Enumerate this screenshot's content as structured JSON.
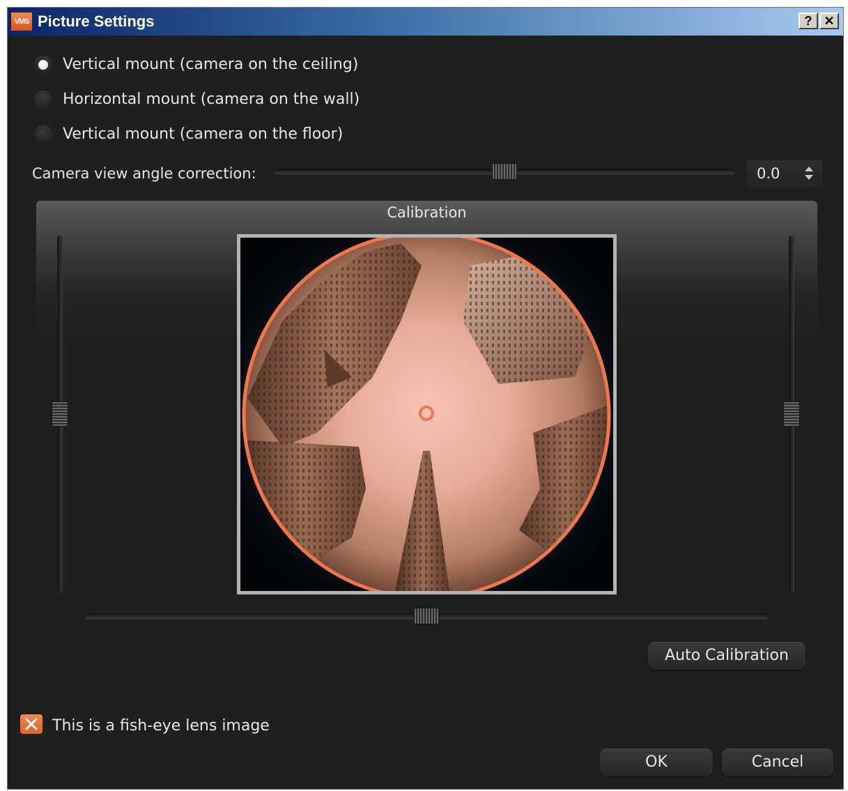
{
  "window": {
    "title": "Picture Settings",
    "logo_text": "VMS",
    "help_button": "?",
    "close_button": "✕"
  },
  "mount_options": [
    {
      "label": "Vertical mount (camera on the ceiling)",
      "checked": true
    },
    {
      "label": "Horizontal mount (camera on the wall)",
      "checked": false
    },
    {
      "label": "Vertical mount (camera on the floor)",
      "checked": false
    }
  ],
  "angle_correction": {
    "label": "Camera view angle correction:",
    "value": "0.0",
    "slider_position": 0.5
  },
  "calibration": {
    "title": "Calibration",
    "horizontal_slider_position": 0.5,
    "left_slider_position": 0.5,
    "right_slider_position": 0.5,
    "auto_button": "Auto Calibration"
  },
  "fisheye_checkbox": {
    "label": "This is a fish-eye lens image",
    "checked": true,
    "check_icon": "✕"
  },
  "footer": {
    "ok_button": "OK",
    "cancel_button": "Cancel"
  },
  "colors": {
    "accent": "#f0774a",
    "background": "#1f1f1f",
    "text": "#e6e6e6"
  },
  "icons": {
    "logo": "vms-logo-icon",
    "spin": "spin-arrows-icon",
    "check": "check-x-icon",
    "center": "center-marker-icon"
  }
}
